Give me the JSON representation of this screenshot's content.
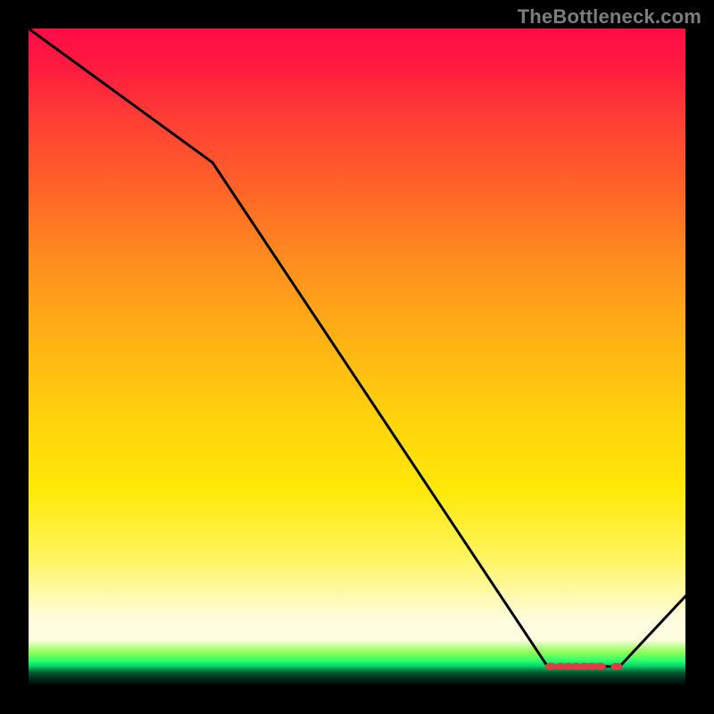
{
  "watermark": "TheBottleneck.com",
  "chart_data": {
    "type": "line",
    "title": "",
    "xlabel": "",
    "ylabel": "",
    "x": [
      0.0,
      0.04,
      0.28,
      0.79,
      0.8,
      0.82,
      0.83,
      0.84,
      0.85,
      0.86,
      0.88,
      0.9,
      1.0
    ],
    "y": [
      1.03,
      1.0,
      0.82,
      0.03,
      0.03,
      0.03,
      0.03,
      0.03,
      0.03,
      0.03,
      0.03,
      0.03,
      0.14
    ],
    "ylim": [
      0,
      1.03
    ],
    "xlim": [
      0,
      1
    ],
    "grid": false,
    "series_color": "#000000",
    "marker": {
      "x": [
        0.795,
        0.81,
        0.822,
        0.834,
        0.846,
        0.858,
        0.87,
        0.895
      ],
      "y": [
        0.03,
        0.03,
        0.03,
        0.03,
        0.03,
        0.03,
        0.03,
        0.03
      ],
      "color": "#e63946",
      "size": 5
    },
    "background_gradient": {
      "stops": [
        {
          "pos": 0.0,
          "color": "#ff0d47"
        },
        {
          "pos": 0.26,
          "color": "#ff6a26"
        },
        {
          "pos": 0.6,
          "color": "#ffd40c"
        },
        {
          "pos": 0.9,
          "color": "#fffde0"
        },
        {
          "pos": 0.96,
          "color": "#2eff6f"
        },
        {
          "pos": 1.0,
          "color": "#000000"
        }
      ]
    }
  }
}
